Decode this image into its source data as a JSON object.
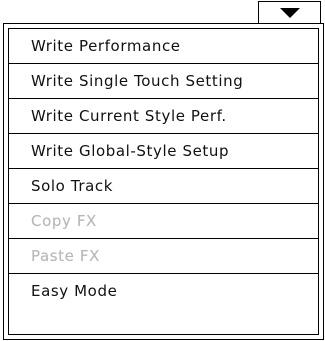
{
  "dropdown": {
    "icon": "triangle-down-icon"
  },
  "menu": {
    "items": [
      {
        "label": "Write Performance",
        "enabled": true
      },
      {
        "label": "Write Single Touch Setting",
        "enabled": true
      },
      {
        "label": "Write Current Style Perf.",
        "enabled": true
      },
      {
        "label": "Write Global-Style Setup",
        "enabled": true
      },
      {
        "label": "Solo Track",
        "enabled": true
      },
      {
        "label": "Copy FX",
        "enabled": false
      },
      {
        "label": "Paste FX",
        "enabled": false
      },
      {
        "label": "Easy Mode",
        "enabled": true
      }
    ]
  }
}
